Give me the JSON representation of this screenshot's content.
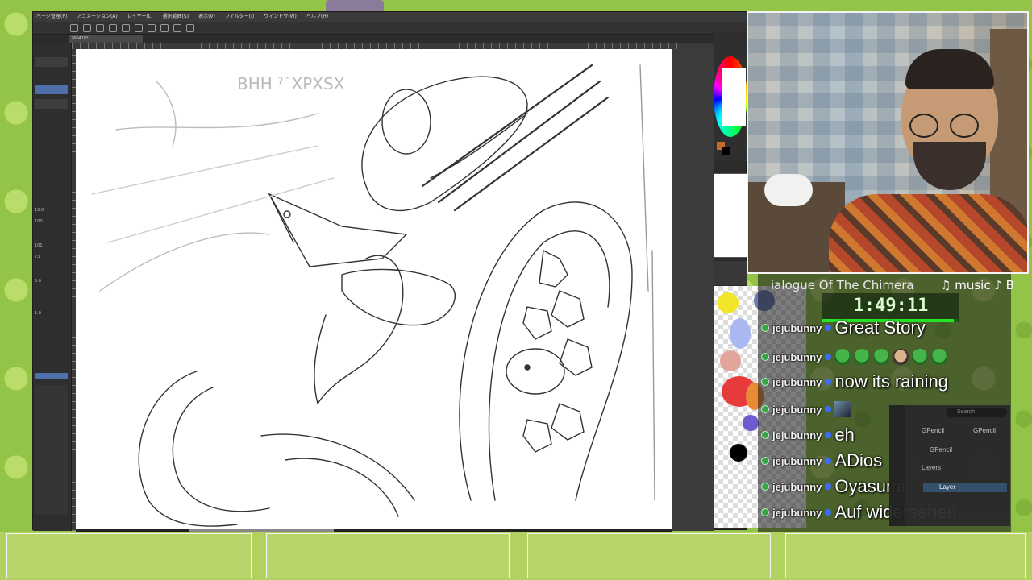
{
  "app": {
    "menu": [
      "ページ管理(P)",
      "アニメーション(A)",
      "レイヤー(L)",
      "選択範囲(S)",
      "表示(V)",
      "フィルター(I)",
      "ウィンドウ(W)",
      "ヘルプ(H)"
    ],
    "doc_tab": "260418*",
    "left_panel_values": [
      "15.0",
      "100",
      "101",
      "73",
      "5.0",
      "1.0"
    ],
    "sketch_title_scribble": "BHH ˀ˙XPXSX"
  },
  "stream": {
    "now_playing": "ialogue Of The Chimera",
    "music_label": "♫ music ♪ B",
    "timer": "1:49:11",
    "timer_progress": 0.97
  },
  "chat": [
    {
      "user": "jejubunny",
      "message": "Great Story"
    },
    {
      "user": "jejubunny",
      "message": "",
      "emotes": [
        "green",
        "green",
        "green",
        "face",
        "green",
        "green"
      ]
    },
    {
      "user": "jejubunny",
      "message": "now its raining"
    },
    {
      "user": "jejubunny",
      "message": "",
      "emotes": [
        "image"
      ]
    },
    {
      "user": "jejubunny",
      "message": "eh"
    },
    {
      "user": "jejubunny",
      "message": "ADios"
    },
    {
      "user": "jejubunny",
      "message": "Oyasumi"
    },
    {
      "user": "jejubunny",
      "message": "Auf widersehen"
    }
  ],
  "blender": {
    "search_placeholder": "Search",
    "breadcrumb_a": "GPencil",
    "breadcrumb_b": "GPencil",
    "object": "GPencil",
    "section": "Layers",
    "layer": "Layer"
  },
  "colors": {
    "background": "#93c447",
    "timer_fill": "#25e425",
    "chat_badge": "#3aa34a"
  }
}
